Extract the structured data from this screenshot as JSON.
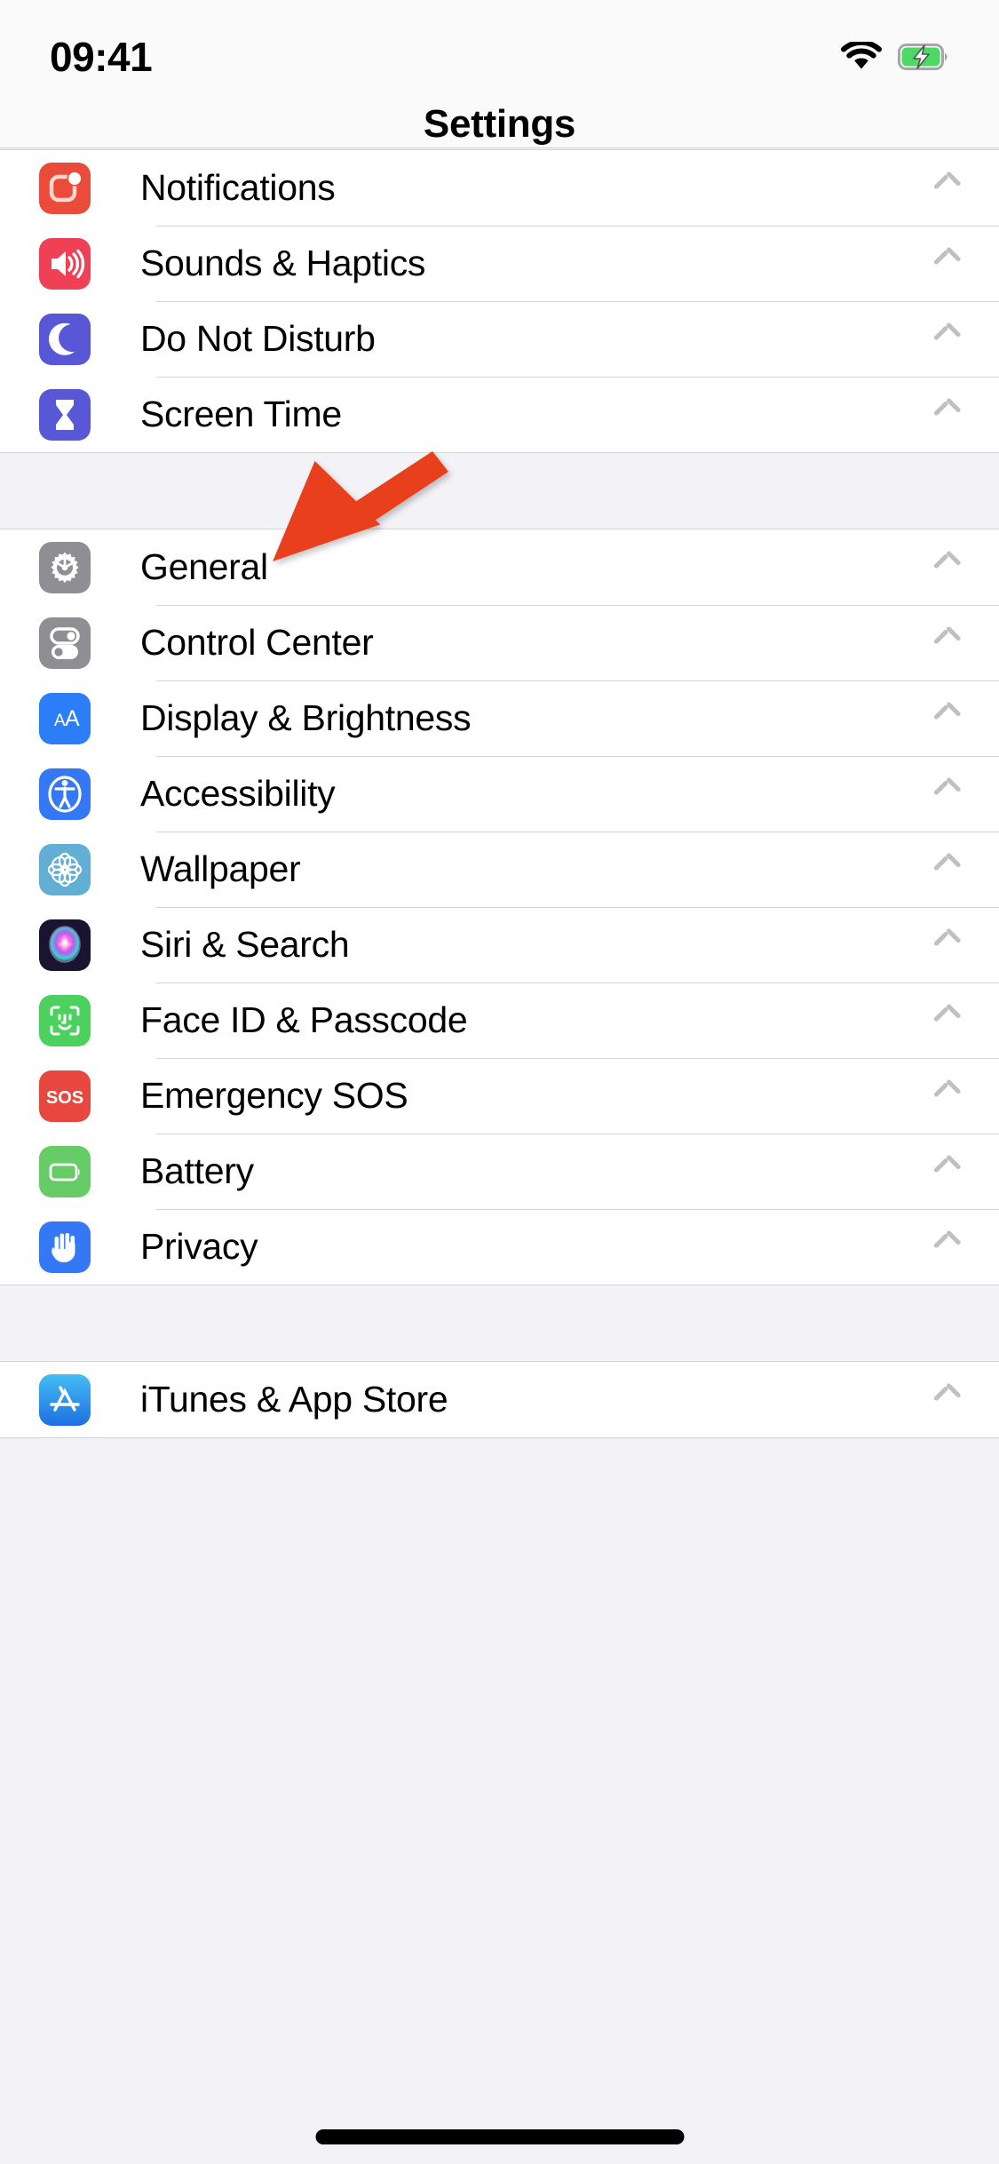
{
  "status_bar": {
    "time": "09:41",
    "wifi_icon": "wifi-icon",
    "battery_icon": "battery-charging-icon",
    "battery_color": "#4CD964"
  },
  "navbar": {
    "title": "Settings"
  },
  "annotation": {
    "type": "arrow",
    "color": "#E8401F",
    "points_to": "General",
    "direction": "down-left"
  },
  "groups": [
    {
      "name": "notifications-group",
      "rows": [
        {
          "label": "Notifications",
          "icon": "notifications-icon",
          "icon_bg": "#EB4B3A",
          "chevron": "chevron-right-icon"
        },
        {
          "label": "Sounds & Haptics",
          "icon": "speaker-icon",
          "icon_bg": "#EF4056",
          "chevron": "chevron-right-icon"
        },
        {
          "label": "Do Not Disturb",
          "icon": "moon-icon",
          "icon_bg": "#5857D6",
          "chevron": "chevron-right-icon"
        },
        {
          "label": "Screen Time",
          "icon": "hourglass-icon",
          "icon_bg": "#5857D6",
          "chevron": "chevron-right-icon"
        }
      ]
    },
    {
      "name": "general-group",
      "rows": [
        {
          "label": "General",
          "icon": "gear-icon",
          "icon_bg": "#8E8E93",
          "chevron": "chevron-right-icon"
        },
        {
          "label": "Control Center",
          "icon": "toggles-icon",
          "icon_bg": "#8E8E93",
          "chevron": "chevron-right-icon"
        },
        {
          "label": "Display & Brightness",
          "icon": "text-size-icon",
          "icon_bg": "#2C7EF8",
          "chevron": "chevron-right-icon"
        },
        {
          "label": "Accessibility",
          "icon": "accessibility-icon",
          "icon_bg": "#3478F6",
          "chevron": "chevron-right-icon"
        },
        {
          "label": "Wallpaper",
          "icon": "flower-icon",
          "icon_bg": "#62AED4",
          "chevron": "chevron-right-icon"
        },
        {
          "label": "Siri & Search",
          "icon": "siri-orb-icon",
          "icon_bg": "#1B1430",
          "chevron": "chevron-right-icon"
        },
        {
          "label": "Face ID & Passcode",
          "icon": "face-id-icon",
          "icon_bg": "#4CD15F",
          "chevron": "chevron-right-icon"
        },
        {
          "label": "Emergency SOS",
          "icon": "sos-icon",
          "icon_bg": "#E8473F",
          "chevron": "chevron-right-icon"
        },
        {
          "label": "Battery",
          "icon": "battery-icon",
          "icon_bg": "#66CC66",
          "chevron": "chevron-right-icon"
        },
        {
          "label": "Privacy",
          "icon": "hand-icon",
          "icon_bg": "#3478F6",
          "chevron": "chevron-right-icon"
        }
      ]
    },
    {
      "name": "stores-group",
      "rows": [
        {
          "label": "iTunes & App Store",
          "icon": "app-store-icon",
          "icon_bg": "#2E9CF4",
          "chevron": "chevron-right-icon"
        }
      ]
    }
  ]
}
